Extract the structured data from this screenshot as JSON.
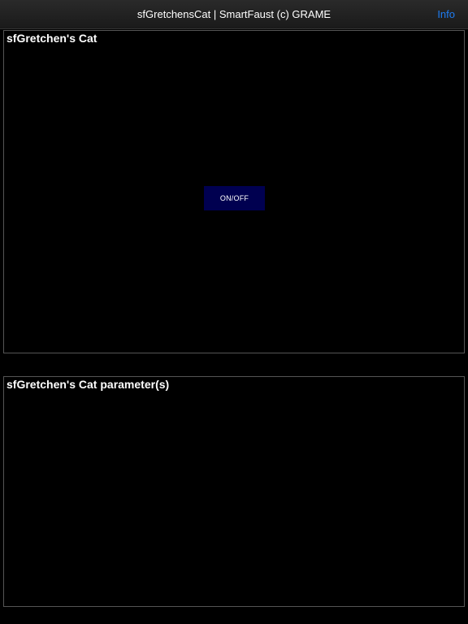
{
  "navbar": {
    "title": "sfGretchensCat | SmartFaust (c) GRAME",
    "info_label": "Info"
  },
  "main_panel": {
    "label": "sfGretchen's Cat",
    "onoff_label": "ON/OFF"
  },
  "params_panel": {
    "label": "sfGretchen's Cat parameter(s)"
  },
  "colors": {
    "background": "#000000",
    "accent": "#1e7cf2",
    "button": "#000050"
  }
}
